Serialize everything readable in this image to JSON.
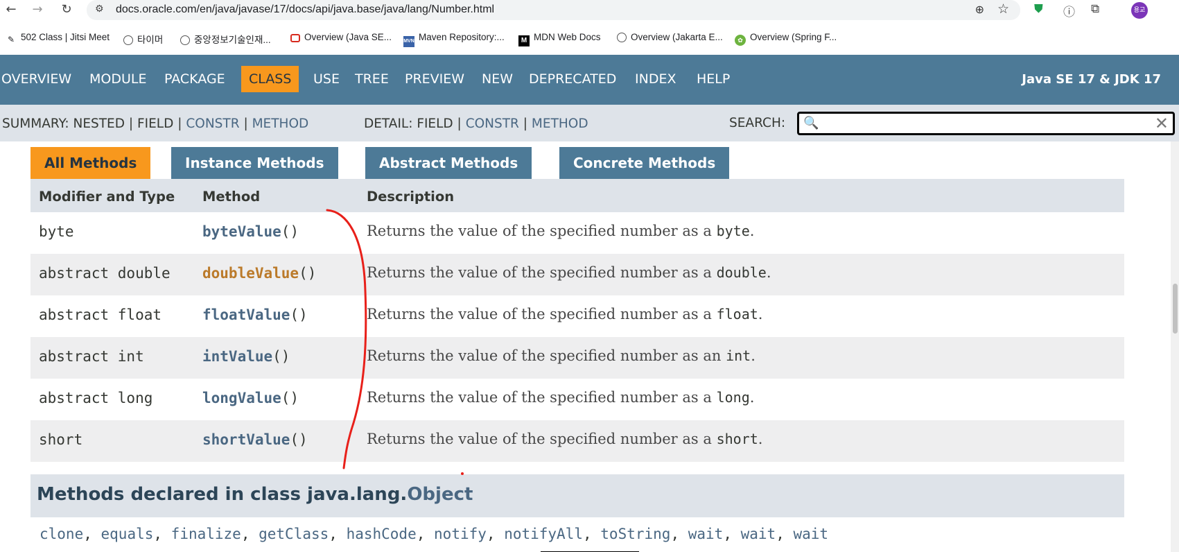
{
  "browser": {
    "url": "docs.oracle.com/en/java/javase/17/docs/api/java.base/java/lang/Number.html",
    "avatar_text": "용교",
    "bookmarks": [
      {
        "label": "502 Class | Jitsi Meet",
        "icon": "jitsi-icon"
      },
      {
        "label": "타이머",
        "icon": "globe-icon"
      },
      {
        "label": "중앙정보기술인재...",
        "icon": "globe-icon"
      },
      {
        "label": "Overview (Java SE...",
        "icon": "oracle-icon"
      },
      {
        "label": "Maven Repository:...",
        "icon": "maven-icon"
      },
      {
        "label": "MDN Web Docs",
        "icon": "mdn-icon"
      },
      {
        "label": "Overview (Jakarta E...",
        "icon": "globe-icon"
      },
      {
        "label": "Overview (Spring F...",
        "icon": "spring-icon"
      }
    ]
  },
  "topnav": {
    "items": [
      "OVERVIEW",
      "MODULE",
      "PACKAGE",
      "CLASS",
      "USE",
      "TREE",
      "PREVIEW",
      "NEW",
      "DEPRECATED",
      "INDEX",
      "HELP"
    ],
    "active": "CLASS",
    "brand": "Java SE 17 & JDK 17"
  },
  "subnav": {
    "summary_label": "SUMMARY: NESTED | FIELD |",
    "summary_constr": "CONSTR",
    "summary_sep": "|",
    "summary_method": "METHOD",
    "detail_label": "DETAIL: FIELD |",
    "detail_constr": "CONSTR",
    "detail_sep": "|",
    "detail_method": "METHOD",
    "search_label": "SEARCH:",
    "search_value": ""
  },
  "method_tabs": [
    "All Methods",
    "Instance Methods",
    "Abstract Methods",
    "Concrete Methods"
  ],
  "method_table": {
    "headers": [
      "Modifier and Type",
      "Method",
      "Description"
    ],
    "rows": [
      {
        "modifier": "byte",
        "method": "byteValue",
        "parens": "()",
        "desc_prefix": "Returns the value of the specified number as a ",
        "desc_code": "byte",
        "desc_suffix": "."
      },
      {
        "modifier": "abstract double",
        "method": "doubleValue",
        "parens": "()",
        "desc_prefix": "Returns the value of the specified number as a ",
        "desc_code": "double",
        "desc_suffix": "."
      },
      {
        "modifier": "abstract float",
        "method": "floatValue",
        "parens": "()",
        "desc_prefix": "Returns the value of the specified number as a ",
        "desc_code": "float",
        "desc_suffix": "."
      },
      {
        "modifier": "abstract int",
        "method": "intValue",
        "parens": "()",
        "desc_prefix": "Returns the value of the specified number as an ",
        "desc_code": "int",
        "desc_suffix": "."
      },
      {
        "modifier": "abstract long",
        "method": "longValue",
        "parens": "()",
        "desc_prefix": "Returns the value of the specified number as a ",
        "desc_code": "long",
        "desc_suffix": "."
      },
      {
        "modifier": "short",
        "method": "shortValue",
        "parens": "()",
        "desc_prefix": "Returns the value of the specified number as a ",
        "desc_code": "short",
        "desc_suffix": "."
      }
    ]
  },
  "inherited": {
    "heading_prefix": "Methods declared in class java.lang.",
    "heading_link": "Object",
    "methods": [
      "clone",
      "equals",
      "finalize",
      "getClass",
      "hashCode",
      "notify",
      "notifyAll",
      "toString",
      "wait",
      "wait",
      "wait"
    ]
  },
  "colors": {
    "nav_bg": "#4d7a97",
    "active_orange": "#f8981d",
    "link": "#4a6782",
    "hover_link": "#bb7a2a",
    "annotation_red": "#e8201a"
  }
}
